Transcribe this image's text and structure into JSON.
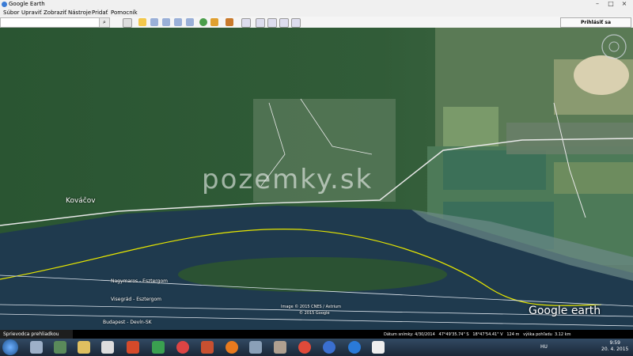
{
  "window": {
    "title": "Google Earth",
    "min": "–",
    "max": "□",
    "close": "×"
  },
  "menu": [
    "Súbor",
    "Upraviť",
    "Zobraziť",
    "Nástroje",
    "Pridať",
    "Pomocník"
  ],
  "toolbar": {
    "search_icon": "search-icon",
    "signin_label": "Prihlásiť sa"
  },
  "map": {
    "place_label": "Kováčov",
    "watermark": "pozemky.sk",
    "route_labels": [
      "Nagymaros - Esztergom",
      "Visegrád - Esztergom",
      "Budapest - Devín-SK"
    ],
    "attribution": [
      "Image © 2015 CNES / Astrium",
      "© 2015 Google"
    ],
    "logo": "Google earth"
  },
  "status": {
    "date": "Dátum snímky: 4/30/2014",
    "lat": "47°49'35.74\" S",
    "lon": "18°47'54.41\" V",
    "elev": "124 m",
    "eye": "výška pohľadu",
    "eye_val": "3.12 km"
  },
  "sidebar_tab": "Sprievodca prehliadkou",
  "taskbar": {
    "lang": "HU",
    "time": "9:59",
    "date": "20. 4. 2015"
  },
  "colors": {
    "water": "#1f3a4e",
    "forest": "#2f5a36",
    "fields": "#5f8a5c",
    "route": "#e6e600"
  }
}
